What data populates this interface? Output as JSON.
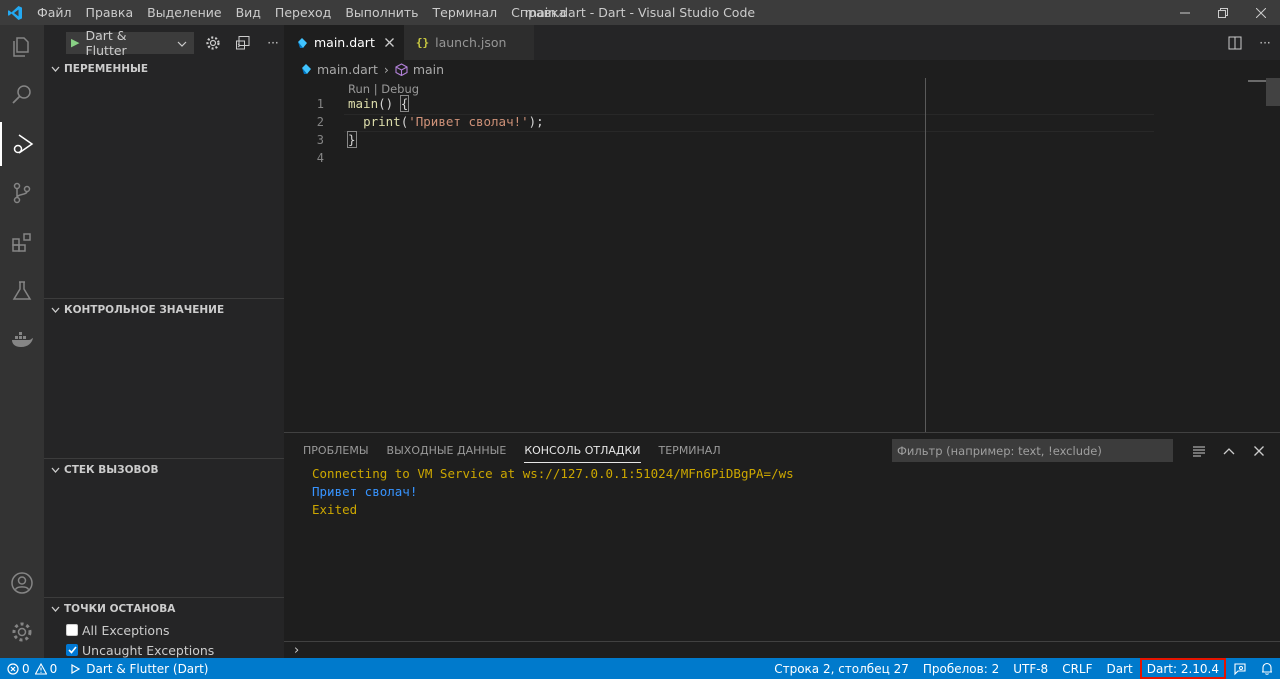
{
  "titlebar": {
    "menu": [
      "Файл",
      "Правка",
      "Выделение",
      "Вид",
      "Переход",
      "Выполнить",
      "Терминал",
      "Справка"
    ],
    "title": "main.dart - Dart - Visual Studio Code"
  },
  "activitybar": {
    "items": [
      "files-icon",
      "search-icon",
      "run-debug-icon",
      "source-control-icon",
      "extensions-icon",
      "testing-icon",
      "docker-icon"
    ],
    "bottom": [
      "accounts-icon",
      "manage-gear-icon"
    ]
  },
  "sidebar": {
    "run_config": "Dart & Flutter",
    "sections": {
      "variables": "ПЕРЕМЕННЫЕ",
      "watch": "КОНТРОЛЬНОЕ ЗНАЧЕНИЕ",
      "callstack": "СТЕК ВЫЗОВОВ",
      "breakpoints": "ТОЧКИ ОСТАНОВА"
    },
    "breakpoints": [
      {
        "label": "All Exceptions",
        "checked": false
      },
      {
        "label": "Uncaught Exceptions",
        "checked": true
      }
    ]
  },
  "tabs": [
    {
      "label": "main.dart",
      "active": true
    },
    {
      "label": "launch.json",
      "active": false
    }
  ],
  "breadcrumb": {
    "file": "main.dart",
    "symbol": "main"
  },
  "editor": {
    "codelens": "Run | Debug",
    "line_numbers": [
      "1",
      "2",
      "3",
      "4"
    ],
    "lines": {
      "l1_fn": "main",
      "l1_rest": "() ",
      "l1_brace": "{",
      "l2_indent": "  ",
      "l2_fn": "print",
      "l2_open": "(",
      "l2_str": "'Привет сволач!'",
      "l2_close": ");",
      "l3_brace": "}"
    }
  },
  "panel": {
    "tabs": [
      "ПРОБЛЕМЫ",
      "ВЫХОДНЫЕ ДАННЫЕ",
      "КОНСОЛЬ ОТЛАДКИ",
      "ТЕРМИНАЛ"
    ],
    "active_tab": "КОНСОЛЬ ОТЛАДКИ",
    "filter_placeholder": "Фильтр (например: text, !exclude)",
    "output": [
      {
        "text": "Connecting to VM Service at ws://127.0.0.1:51024/MFn6PiDBgPA=/ws",
        "color": "#cca700"
      },
      {
        "text": "Привет сволач!",
        "color": "#3794ff"
      },
      {
        "text": "Exited",
        "color": "#cca700"
      }
    ],
    "prompt": "›"
  },
  "statusbar": {
    "errors": "0",
    "warnings": "0",
    "debug_config": "Dart & Flutter (Dart)",
    "position": "Строка 2, столбец 27",
    "spaces": "Пробелов: 2",
    "encoding": "UTF-8",
    "eol": "CRLF",
    "language": "Dart",
    "sdk": "Dart: 2.10.4"
  },
  "colors": {
    "accent": "#007acc",
    "highlight_box": "#e51400"
  }
}
